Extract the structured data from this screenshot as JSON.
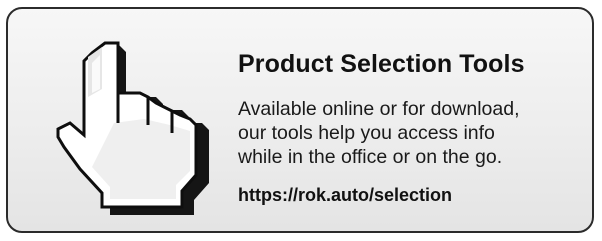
{
  "card": {
    "title": "Product Selection Tools",
    "description_lines": [
      "Available online or for download,",
      "our tools help you access info",
      "while in the office or on the go."
    ],
    "url": "https://rok.auto/selection",
    "icon": "pointing-hand-cursor-icon",
    "colors": {
      "border": "#2b2b2b",
      "text": "#111111",
      "background_top": "#f7f7f7",
      "background_bottom": "#e4e4e4"
    }
  }
}
